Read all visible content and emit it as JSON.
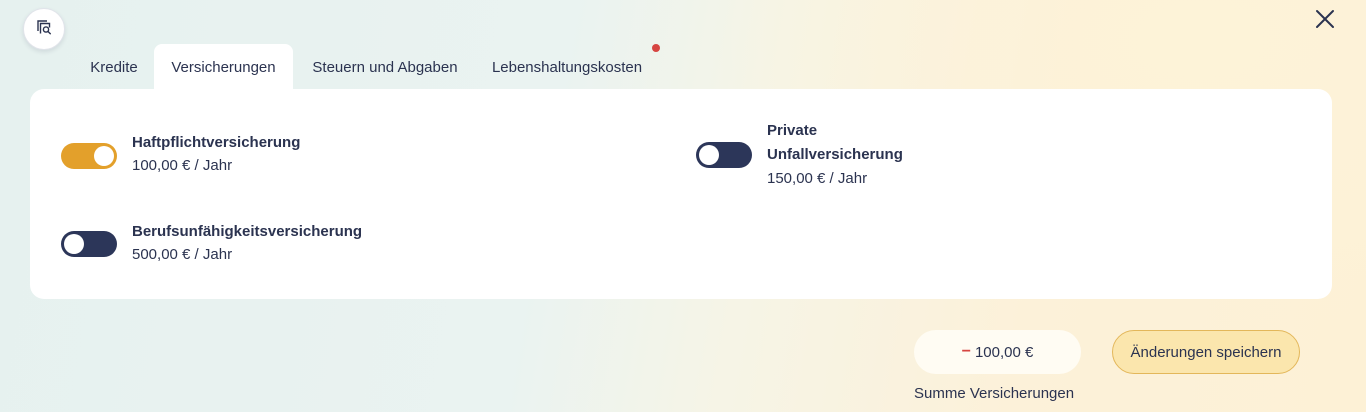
{
  "tabs": [
    {
      "label": "Kredite",
      "active": false
    },
    {
      "label": "Versicherungen",
      "active": true
    },
    {
      "label": "Steuern und Abgaben",
      "active": false
    },
    {
      "label": "Lebenshaltungskosten",
      "active": false,
      "has_notification": true
    }
  ],
  "insurances": [
    {
      "name": "Haftpflichtversicherung",
      "price": "100,00 € / Jahr",
      "enabled": true
    },
    {
      "name_line1": "Private",
      "name_line2": "Unfallversicherung",
      "price": "150,00 € / Jahr",
      "enabled": false
    },
    {
      "name": "Berufsunfähigkeitsversicherung",
      "price": "500,00 € / Jahr",
      "enabled": false
    }
  ],
  "summary": {
    "sign": "−",
    "amount": "100,00 €",
    "label": "Summe Versicherungen"
  },
  "save_button": {
    "label": "Änderungen speichern"
  },
  "icons": {
    "search": "search-document-icon",
    "close": "close-icon"
  },
  "colors": {
    "accent": "#e3a02b",
    "toggle_off": "#2c3659",
    "negative": "#d64541",
    "text": "#2b3350"
  }
}
